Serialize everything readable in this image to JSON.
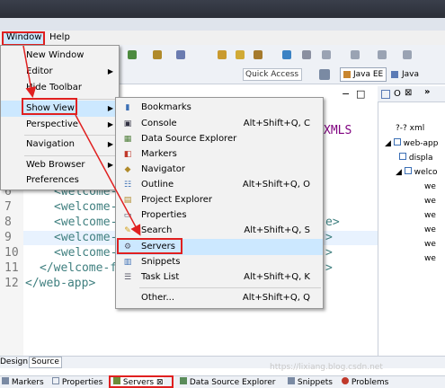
{
  "menubar": {
    "window": "Window",
    "help": "Help"
  },
  "toolbar": {
    "quick_access_placeholder": "Quick Access",
    "perspective_java_ee": "Java EE",
    "perspective_java": "Java"
  },
  "window_menu": [
    {
      "label": "New Window",
      "submenu": false
    },
    {
      "label": "Editor",
      "submenu": true
    },
    {
      "label": "Hide Toolbar",
      "submenu": false
    },
    {
      "label": "Show View",
      "submenu": true
    },
    {
      "label": "Perspective",
      "submenu": true
    },
    {
      "label": "Navigation",
      "submenu": true
    },
    {
      "label": "Web Browser",
      "submenu": true
    },
    {
      "label": "Preferences",
      "submenu": false
    }
  ],
  "show_view_menu": [
    {
      "label": "Bookmarks",
      "shortcut": "",
      "icon": "bookmark-icon"
    },
    {
      "label": "Console",
      "shortcut": "Alt+Shift+Q, C",
      "icon": "console-icon"
    },
    {
      "label": "Data Source Explorer",
      "shortcut": "",
      "icon": "database-icon"
    },
    {
      "label": "Markers",
      "shortcut": "",
      "icon": "markers-icon"
    },
    {
      "label": "Navigator",
      "shortcut": "",
      "icon": "navigator-icon"
    },
    {
      "label": "Outline",
      "shortcut": "Alt+Shift+Q, O",
      "icon": "outline-icon"
    },
    {
      "label": "Project Explorer",
      "shortcut": "",
      "icon": "project-explorer-icon"
    },
    {
      "label": "Properties",
      "shortcut": "",
      "icon": "properties-icon"
    },
    {
      "label": "Search",
      "shortcut": "Alt+Shift+Q, S",
      "icon": "search-icon"
    },
    {
      "label": "Servers",
      "shortcut": "",
      "icon": "servers-icon"
    },
    {
      "label": "Snippets",
      "shortcut": "",
      "icon": "snippets-icon"
    },
    {
      "label": "Task List",
      "shortcut": "Alt+Shift+Q, K",
      "icon": "task-list-icon"
    },
    {
      "label": "Other...",
      "shortcut": "Alt+Shift+Q, Q",
      "icon": ""
    }
  ],
  "editor": {
    "lines": [
      {
        "num": "6",
        "text": "<welcome-"
      },
      {
        "num": "7",
        "text": "<welcome-"
      },
      {
        "num": "8",
        "text": "<welcome-"
      },
      {
        "num": "9",
        "text": "<welcome-"
      },
      {
        "num": "10",
        "text": "<welcome-"
      },
      {
        "num": "11",
        "text": "</welcome-f"
      },
      {
        "num": "12",
        "text": "</web-app>"
      }
    ],
    "fragment_xmls": "XMLS",
    "fragment_right_1": "e>",
    "fragment_right_2": ">",
    "fragment_right_3": ">",
    "fragment_right_4": ">",
    "tab_design": "Design",
    "tab_source": "Source"
  },
  "outline": {
    "tab_label": "O",
    "items": [
      {
        "label": "?-? xml"
      },
      {
        "label": "web-app"
      },
      {
        "label": "displa"
      },
      {
        "label": "welco"
      },
      {
        "label": "we"
      },
      {
        "label": "we"
      },
      {
        "label": "we"
      },
      {
        "label": "we"
      },
      {
        "label": "we"
      },
      {
        "label": "we"
      }
    ]
  },
  "bottom_tabs": [
    {
      "label": "Markers"
    },
    {
      "label": "Properties"
    },
    {
      "label": "Servers"
    },
    {
      "label": "Data Source Explorer"
    },
    {
      "label": "Snippets"
    },
    {
      "label": "Problems"
    }
  ],
  "watermark": "https://lixiang.blog.csdn.net",
  "colors": {
    "highlight_red": "#e02020",
    "menu_bg": "#f2f2f2",
    "menu_hover": "#cce8ff"
  }
}
